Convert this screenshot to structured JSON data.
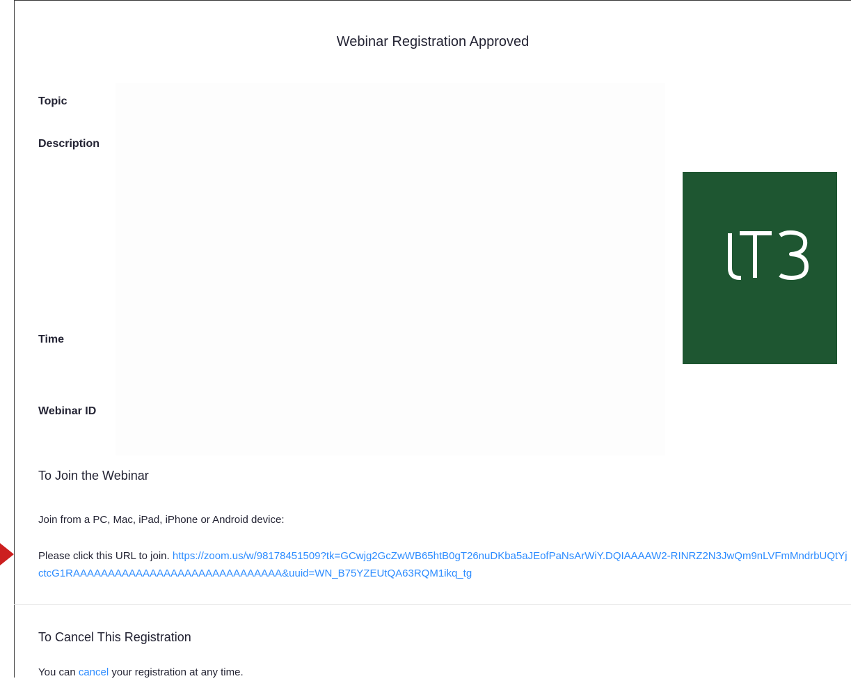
{
  "page": {
    "title": "Webinar Registration Approved"
  },
  "fields": {
    "topic_label": "Topic",
    "topic_value": "",
    "description_label": "Description",
    "description_value": "",
    "time_label": "Time",
    "time_value": "",
    "webinar_id_label": "Webinar ID",
    "webinar_id_value": ""
  },
  "logo": {
    "text": "LT3",
    "background_color": "#1e5631",
    "icon": "lt3-logo-icon"
  },
  "join": {
    "heading": "To Join the Webinar",
    "devices_text": "Join from a PC, Mac, iPad, iPhone or Android device:",
    "click_prompt": "Please click this URL to join.",
    "url": "https://zoom.us/w/98178451509?tk=GCwjg2GcZwWB65htB0gT26nuDKba5aJEofPaNsArWiY.DQIAAAAW2-RINRZ2N3JwQm9nLVFmMndrbUQtYjctcG1RAAAAAAAAAAAAAAAAAAAAAAAAAAAAAA&uuid=WN_B75YZEUtQA63RQM1ikq_tg"
  },
  "cancel": {
    "heading": "To Cancel This Registration",
    "text_before": "You can",
    "link_text": "cancel",
    "text_after": "your registration at any time."
  },
  "annotation": {
    "arrow_icon": "red-arrow-icon",
    "color": "#cc1f1f"
  },
  "colors": {
    "link": "#2d8cff",
    "text": "#232333"
  }
}
